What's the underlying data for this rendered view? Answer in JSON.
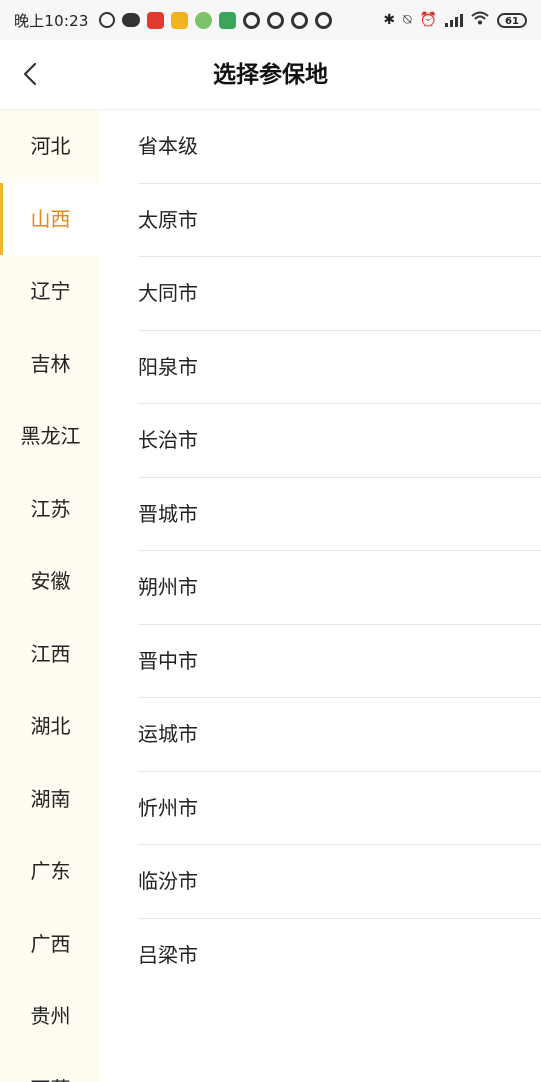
{
  "status_bar": {
    "time": "晚上10:23",
    "battery": "61"
  },
  "header": {
    "title": "选择参保地"
  },
  "sidebar": {
    "items": [
      {
        "label": "河北"
      },
      {
        "label": "山西",
        "active": true
      },
      {
        "label": "辽宁"
      },
      {
        "label": "吉林"
      },
      {
        "label": "黑龙江"
      },
      {
        "label": "江苏"
      },
      {
        "label": "安徽"
      },
      {
        "label": "江西"
      },
      {
        "label": "湖北"
      },
      {
        "label": "湖南"
      },
      {
        "label": "广东"
      },
      {
        "label": "广西"
      },
      {
        "label": "贵州"
      },
      {
        "label": "西藏"
      }
    ]
  },
  "cities": [
    {
      "label": "省本级"
    },
    {
      "label": "太原市"
    },
    {
      "label": "大同市"
    },
    {
      "label": "阳泉市"
    },
    {
      "label": "长治市"
    },
    {
      "label": "晋城市"
    },
    {
      "label": "朔州市"
    },
    {
      "label": "晋中市"
    },
    {
      "label": "运城市"
    },
    {
      "label": "忻州市"
    },
    {
      "label": "临汾市"
    },
    {
      "label": "吕梁市"
    }
  ],
  "colors": {
    "accent": "#e08a1b",
    "sidebar_bg": "#fffcf1",
    "active_bar": "#f0b62d"
  }
}
